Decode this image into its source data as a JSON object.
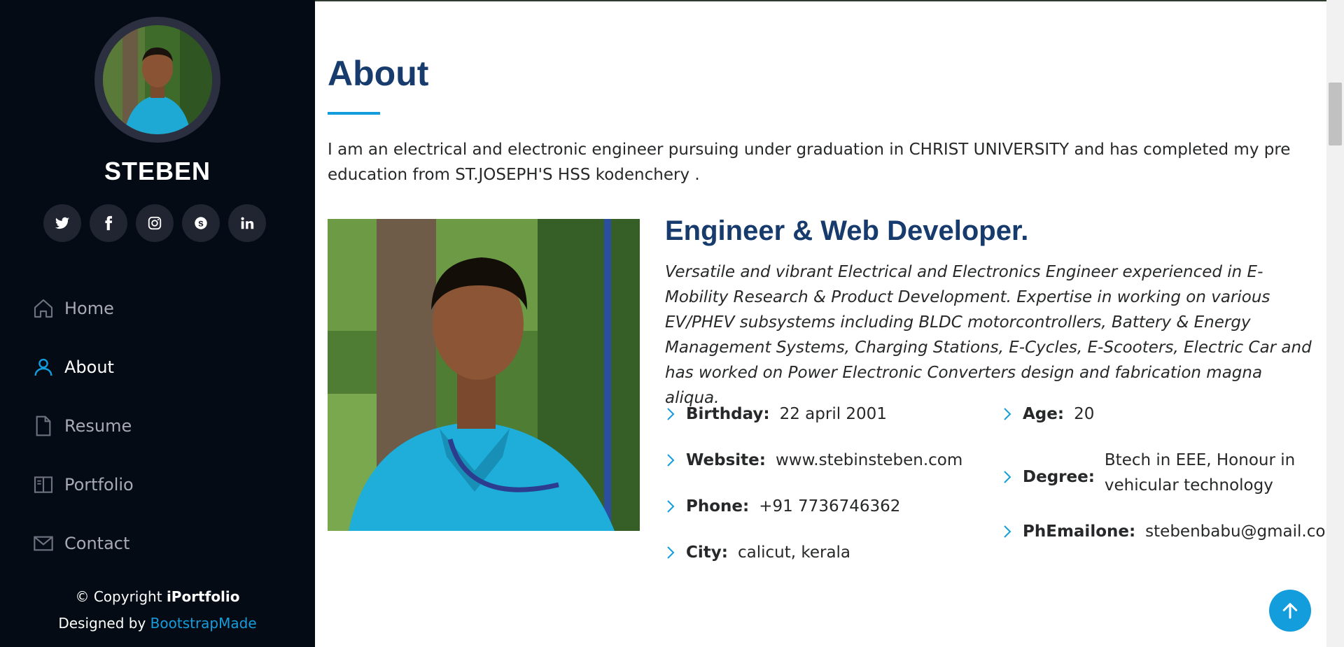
{
  "sidebar": {
    "brand": "STEBEN",
    "social": [
      "twitter-icon",
      "facebook-icon",
      "instagram-icon",
      "skype-icon",
      "linkedin-icon"
    ],
    "nav": [
      {
        "label": "Home",
        "icon": "home-icon"
      },
      {
        "label": "About",
        "icon": "person-icon",
        "active": true
      },
      {
        "label": "Resume",
        "icon": "file-icon"
      },
      {
        "label": "Portfolio",
        "icon": "book-icon"
      },
      {
        "label": "Contact",
        "icon": "envelope-icon"
      }
    ],
    "footer": {
      "copyright_prefix": "© Copyright ",
      "copyright_brand": "iPortfolio",
      "designed_prefix": "Designed by ",
      "designed_link": "BootstrapMade"
    }
  },
  "about": {
    "title": "About",
    "intro": "I am an electrical and electronic engineer pursuing under graduation in CHRIST UNIVERSITY and has completed my pre education from ST.JOSEPH'S HSS kodenchery .",
    "headline": "Engineer & Web Developer.",
    "description": "Versatile and vibrant Electrical and Electronics Engineer experienced in E-Mobility Research & Product Development. Expertise in working on various EV/PHEV subsystems including BLDC motorcontrollers, Battery & Energy Management Systems, Charging Stations, E-Cycles, E-Scooters, Electric Car and has worked on Power Electronic Converters design and fabrication magna aliqua.",
    "facts_left": [
      {
        "key": "Birthday:",
        "value": "22 april 2001"
      },
      {
        "key": "Website:",
        "value": "www.stebinsteben.com"
      },
      {
        "key": "Phone:",
        "value": "+91 7736746362"
      },
      {
        "key": "City:",
        "value": "calicut, kerala"
      }
    ],
    "facts_right": [
      {
        "key": "Age:",
        "value": "20"
      },
      {
        "key": "Degree:",
        "value": "Btech in EEE, Honour in vehicular technology"
      },
      {
        "key": "PhEmailone:",
        "value": "stebenbabu@gmail.com"
      }
    ]
  },
  "colors": {
    "accent": "#149ddd",
    "sidebar_bg": "#040b14",
    "heading": "#173b6c"
  }
}
